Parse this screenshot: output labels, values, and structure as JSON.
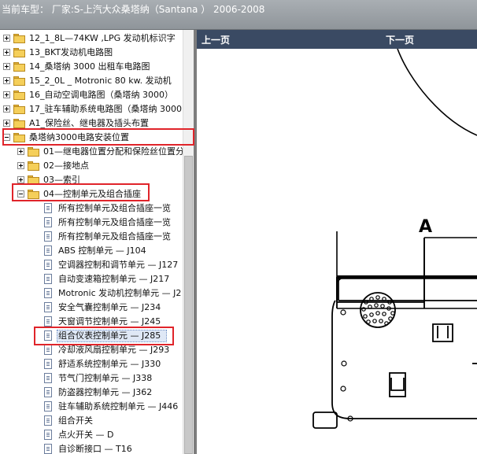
{
  "header": {
    "title": "当前车型： 厂家:S-上汽大众桑塔纳（Santana ） 2006-2008"
  },
  "nav": {
    "prev": "上一页",
    "next": "下一页"
  },
  "tree": [
    {
      "level": 0,
      "type": "folder",
      "expander": "plus",
      "label": "12_1_8L—74KW ,LPG 发动机标识字"
    },
    {
      "level": 0,
      "type": "folder",
      "expander": "plus",
      "label": "13_BKT发动机电路图"
    },
    {
      "level": 0,
      "type": "folder",
      "expander": "plus",
      "label": "14_桑塔纳 3000 出租车电路图"
    },
    {
      "level": 0,
      "type": "folder",
      "expander": "plus",
      "label": "15_2_0L _ Motronic 80 kw.  发动机"
    },
    {
      "level": 0,
      "type": "folder",
      "expander": "plus",
      "label": "16_自动空调电路图（桑塔纳 3000）"
    },
    {
      "level": 0,
      "type": "folder",
      "expander": "plus",
      "label": "17_驻车辅助系统电路图（桑塔纳 3000"
    },
    {
      "level": 0,
      "type": "folder",
      "expander": "plus",
      "label": "A1_保险丝、继电器及插头布置"
    },
    {
      "level": 0,
      "type": "folder",
      "expander": "minus",
      "label": "桑塔纳3000电路安装位置"
    },
    {
      "level": 1,
      "type": "folder",
      "expander": "plus",
      "label": "01—继电器位置分配和保险丝位置分"
    },
    {
      "level": 1,
      "type": "folder",
      "expander": "plus",
      "label": "02—接地点"
    },
    {
      "level": 1,
      "type": "folder",
      "expander": "plus",
      "label": "03—索引"
    },
    {
      "level": 1,
      "type": "folder",
      "expander": "minus",
      "label": "04—控制单元及组合插座"
    },
    {
      "level": 2,
      "type": "page",
      "label": "所有控制单元及组合插座一览"
    },
    {
      "level": 2,
      "type": "page",
      "label": "所有控制单元及组合插座一览"
    },
    {
      "level": 2,
      "type": "page",
      "label": "所有控制单元及组合插座一览"
    },
    {
      "level": 2,
      "type": "page",
      "label": "ABS 控制单元 — J104"
    },
    {
      "level": 2,
      "type": "page",
      "label": "空调器控制和调节单元 — J127"
    },
    {
      "level": 2,
      "type": "page",
      "label": "自动变速箱控制单元 — J217"
    },
    {
      "level": 2,
      "type": "page",
      "label": "Motronic 发动机控制单元 — J2"
    },
    {
      "level": 2,
      "type": "page",
      "label": "安全气囊控制单元 — J234"
    },
    {
      "level": 2,
      "type": "page",
      "label": "天窗调节控制单元 — J245"
    },
    {
      "level": 2,
      "type": "page",
      "label": "组合仪表控制单元 — J285",
      "selected": true
    },
    {
      "level": 2,
      "type": "page",
      "label": "冷却液风扇控制单元 — J293"
    },
    {
      "level": 2,
      "type": "page",
      "label": "舒适系统控制单元 — J330"
    },
    {
      "level": 2,
      "type": "page",
      "label": "节气门控制单元 — J338"
    },
    {
      "level": 2,
      "type": "page",
      "label": "防盗器控制单元 — J362"
    },
    {
      "level": 2,
      "type": "page",
      "label": "驻车辅助系统控制单元 — J446"
    },
    {
      "level": 2,
      "type": "page",
      "label": "组合开关"
    },
    {
      "level": 2,
      "type": "page",
      "label": "点火开关 — D"
    },
    {
      "level": 2,
      "type": "page",
      "label": "自诊断接口 — T16"
    }
  ],
  "diagram": {
    "callout": "A"
  },
  "colors": {
    "header": "#9aa0a5",
    "navbar": "#3a4a63",
    "highlight": "#e0242a",
    "folder": "#f5cf5a"
  }
}
